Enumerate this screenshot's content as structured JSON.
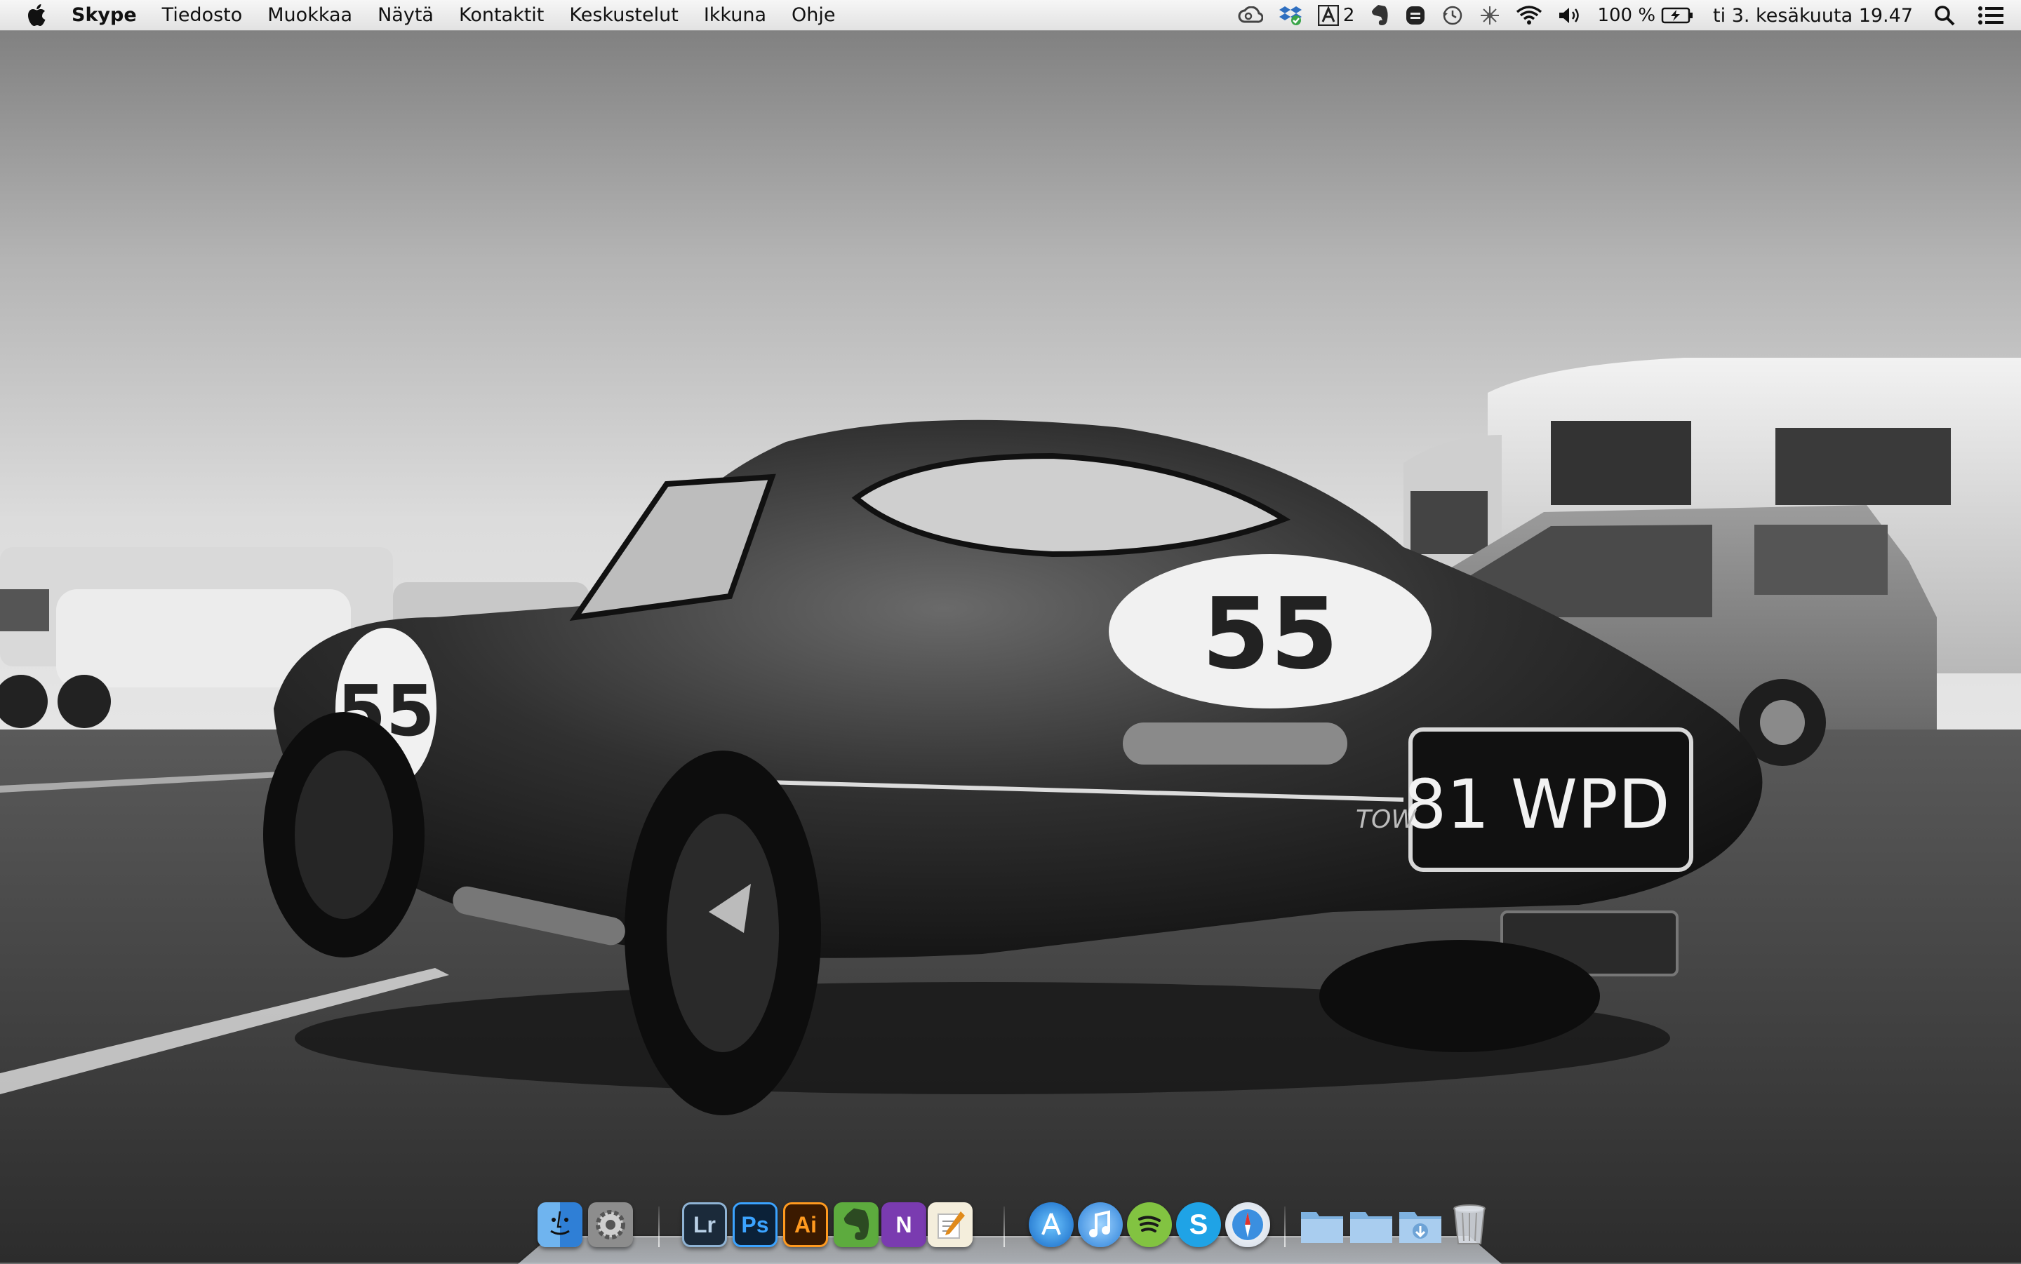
{
  "menubar": {
    "apple_icon": "apple-icon",
    "app_name": "Skype",
    "menus": [
      "Tiedosto",
      "Muokkaa",
      "Näytä",
      "Kontaktit",
      "Keskustelut",
      "Ikkuna",
      "Ohje"
    ],
    "status": {
      "adobe_count": "2",
      "battery": "100 %",
      "clock": "ti 3. kesäkuuta  19.47"
    }
  },
  "wallpaper": {
    "car_number": "55",
    "plate": "81 WPD",
    "tow_label": "TOW"
  },
  "dock": {
    "items": [
      {
        "name": "finder",
        "icon": "finder-icon"
      },
      {
        "name": "system-preferences",
        "icon": "gear-icon"
      },
      {
        "name": "lightroom",
        "label": "Lr"
      },
      {
        "name": "photoshop",
        "label": "Ps"
      },
      {
        "name": "illustrator",
        "label": "Ai"
      },
      {
        "name": "evernote",
        "icon": "elephant-icon"
      },
      {
        "name": "onenote",
        "label": "N"
      },
      {
        "name": "textedit",
        "icon": "pen-icon"
      },
      {
        "name": "app-store",
        "icon": "app-store-icon"
      },
      {
        "name": "itunes",
        "icon": "music-note-icon"
      },
      {
        "name": "spotify",
        "icon": "spotify-icon"
      },
      {
        "name": "skype",
        "label": "S"
      },
      {
        "name": "safari",
        "icon": "compass-icon"
      },
      {
        "name": "applications-folder",
        "icon": "folder-icon"
      },
      {
        "name": "documents-folder",
        "icon": "folder-icon"
      },
      {
        "name": "downloads-folder",
        "icon": "folder-download-icon"
      },
      {
        "name": "trash",
        "icon": "trash-icon"
      }
    ]
  },
  "colors": {
    "menubar": "#e8e8e8",
    "lightroom": "#1b2a3a",
    "photoshop": "#0b2138",
    "illustrator": "#3b1a00",
    "evernote": "#5dab3e",
    "onenote": "#7a3bb0",
    "spotify": "#82c341",
    "skype": "#1fa3e6"
  }
}
